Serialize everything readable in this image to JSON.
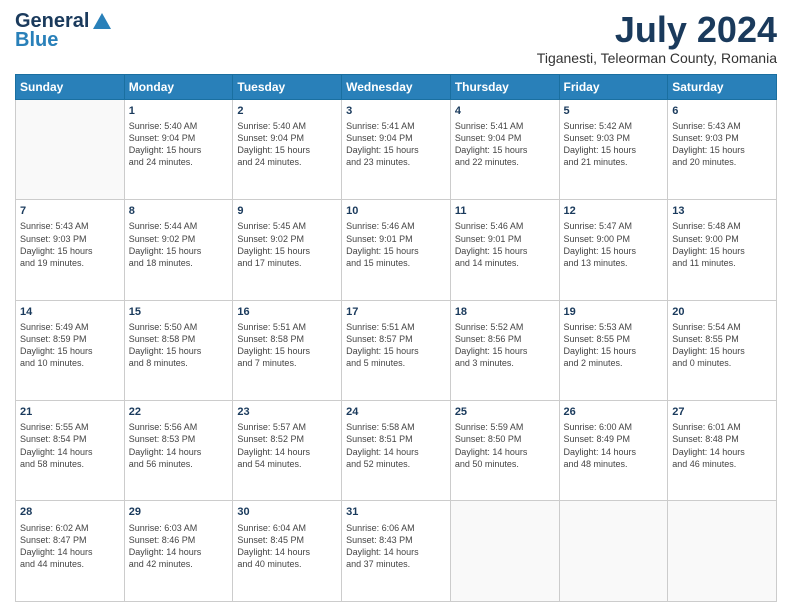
{
  "header": {
    "logo_line1": "General",
    "logo_line2": "Blue",
    "month_year": "July 2024",
    "location": "Tiganesti, Teleorman County, Romania"
  },
  "weekdays": [
    "Sunday",
    "Monday",
    "Tuesday",
    "Wednesday",
    "Thursday",
    "Friday",
    "Saturday"
  ],
  "weeks": [
    [
      {
        "day": "",
        "info": ""
      },
      {
        "day": "1",
        "info": "Sunrise: 5:40 AM\nSunset: 9:04 PM\nDaylight: 15 hours\nand 24 minutes."
      },
      {
        "day": "2",
        "info": "Sunrise: 5:40 AM\nSunset: 9:04 PM\nDaylight: 15 hours\nand 24 minutes."
      },
      {
        "day": "3",
        "info": "Sunrise: 5:41 AM\nSunset: 9:04 PM\nDaylight: 15 hours\nand 23 minutes."
      },
      {
        "day": "4",
        "info": "Sunrise: 5:41 AM\nSunset: 9:04 PM\nDaylight: 15 hours\nand 22 minutes."
      },
      {
        "day": "5",
        "info": "Sunrise: 5:42 AM\nSunset: 9:03 PM\nDaylight: 15 hours\nand 21 minutes."
      },
      {
        "day": "6",
        "info": "Sunrise: 5:43 AM\nSunset: 9:03 PM\nDaylight: 15 hours\nand 20 minutes."
      }
    ],
    [
      {
        "day": "7",
        "info": "Sunrise: 5:43 AM\nSunset: 9:03 PM\nDaylight: 15 hours\nand 19 minutes."
      },
      {
        "day": "8",
        "info": "Sunrise: 5:44 AM\nSunset: 9:02 PM\nDaylight: 15 hours\nand 18 minutes."
      },
      {
        "day": "9",
        "info": "Sunrise: 5:45 AM\nSunset: 9:02 PM\nDaylight: 15 hours\nand 17 minutes."
      },
      {
        "day": "10",
        "info": "Sunrise: 5:46 AM\nSunset: 9:01 PM\nDaylight: 15 hours\nand 15 minutes."
      },
      {
        "day": "11",
        "info": "Sunrise: 5:46 AM\nSunset: 9:01 PM\nDaylight: 15 hours\nand 14 minutes."
      },
      {
        "day": "12",
        "info": "Sunrise: 5:47 AM\nSunset: 9:00 PM\nDaylight: 15 hours\nand 13 minutes."
      },
      {
        "day": "13",
        "info": "Sunrise: 5:48 AM\nSunset: 9:00 PM\nDaylight: 15 hours\nand 11 minutes."
      }
    ],
    [
      {
        "day": "14",
        "info": "Sunrise: 5:49 AM\nSunset: 8:59 PM\nDaylight: 15 hours\nand 10 minutes."
      },
      {
        "day": "15",
        "info": "Sunrise: 5:50 AM\nSunset: 8:58 PM\nDaylight: 15 hours\nand 8 minutes."
      },
      {
        "day": "16",
        "info": "Sunrise: 5:51 AM\nSunset: 8:58 PM\nDaylight: 15 hours\nand 7 minutes."
      },
      {
        "day": "17",
        "info": "Sunrise: 5:51 AM\nSunset: 8:57 PM\nDaylight: 15 hours\nand 5 minutes."
      },
      {
        "day": "18",
        "info": "Sunrise: 5:52 AM\nSunset: 8:56 PM\nDaylight: 15 hours\nand 3 minutes."
      },
      {
        "day": "19",
        "info": "Sunrise: 5:53 AM\nSunset: 8:55 PM\nDaylight: 15 hours\nand 2 minutes."
      },
      {
        "day": "20",
        "info": "Sunrise: 5:54 AM\nSunset: 8:55 PM\nDaylight: 15 hours\nand 0 minutes."
      }
    ],
    [
      {
        "day": "21",
        "info": "Sunrise: 5:55 AM\nSunset: 8:54 PM\nDaylight: 14 hours\nand 58 minutes."
      },
      {
        "day": "22",
        "info": "Sunrise: 5:56 AM\nSunset: 8:53 PM\nDaylight: 14 hours\nand 56 minutes."
      },
      {
        "day": "23",
        "info": "Sunrise: 5:57 AM\nSunset: 8:52 PM\nDaylight: 14 hours\nand 54 minutes."
      },
      {
        "day": "24",
        "info": "Sunrise: 5:58 AM\nSunset: 8:51 PM\nDaylight: 14 hours\nand 52 minutes."
      },
      {
        "day": "25",
        "info": "Sunrise: 5:59 AM\nSunset: 8:50 PM\nDaylight: 14 hours\nand 50 minutes."
      },
      {
        "day": "26",
        "info": "Sunrise: 6:00 AM\nSunset: 8:49 PM\nDaylight: 14 hours\nand 48 minutes."
      },
      {
        "day": "27",
        "info": "Sunrise: 6:01 AM\nSunset: 8:48 PM\nDaylight: 14 hours\nand 46 minutes."
      }
    ],
    [
      {
        "day": "28",
        "info": "Sunrise: 6:02 AM\nSunset: 8:47 PM\nDaylight: 14 hours\nand 44 minutes."
      },
      {
        "day": "29",
        "info": "Sunrise: 6:03 AM\nSunset: 8:46 PM\nDaylight: 14 hours\nand 42 minutes."
      },
      {
        "day": "30",
        "info": "Sunrise: 6:04 AM\nSunset: 8:45 PM\nDaylight: 14 hours\nand 40 minutes."
      },
      {
        "day": "31",
        "info": "Sunrise: 6:06 AM\nSunset: 8:43 PM\nDaylight: 14 hours\nand 37 minutes."
      },
      {
        "day": "",
        "info": ""
      },
      {
        "day": "",
        "info": ""
      },
      {
        "day": "",
        "info": ""
      }
    ]
  ]
}
